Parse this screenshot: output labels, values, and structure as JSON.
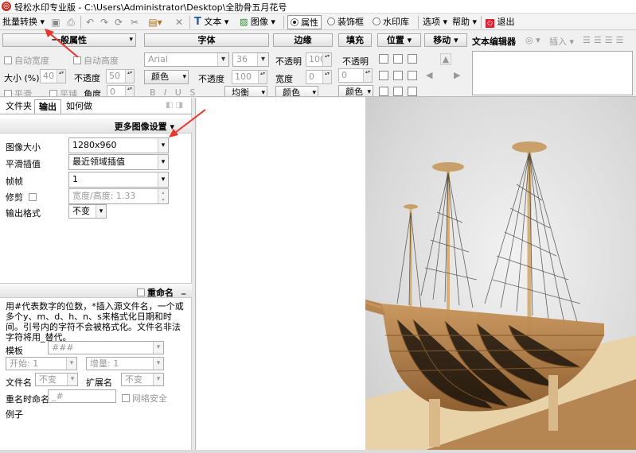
{
  "title": "轻松水印专业版 - C:\\Users\\Administrator\\Desktop\\全肋骨五月花号",
  "menu": {
    "batch": "批量转换",
    "text": "文本",
    "image": "图像",
    "props": "属性",
    "deco": "装饰框",
    "wmlib": "水印库",
    "options": "选项",
    "help": "帮助",
    "exit": "退出"
  },
  "ribbon": {
    "general": "一般属性",
    "font": "字体",
    "border": "边缘",
    "fill": "填充",
    "position": "位置",
    "move": "移动",
    "text_editor": "文本编辑器",
    "insert": "插入",
    "auto_width": "自动宽度",
    "auto_height": "自动高度",
    "font_name": "Arial",
    "font_size": "36",
    "opacity": "不透明",
    "opacity_val": "100",
    "size_pct": "大小 (%)",
    "size_val": "40",
    "opacity2": "不透度",
    "opacity2_val": "50",
    "color": "颜色",
    "opacity3": "不透度",
    "opacity3_val": "100",
    "width": "宽度",
    "width_val": "0",
    "fill_val": "0",
    "smooth": "平滑",
    "tile": "平铺",
    "angle": "角度",
    "angle_val": "0",
    "align": "均衡",
    "color2": "颜色",
    "color3": "颜色"
  },
  "left": {
    "tabs": [
      "文件夹",
      "输出",
      "如何做"
    ],
    "more_settings": "更多图像设置",
    "image_size_label": "图像大小",
    "image_size": "1280x960",
    "smooth_label": "平滑插值",
    "smooth_val": "最近领域插值",
    "frame_label": "帧帧",
    "frame_val": "1",
    "crop_label": "修剪",
    "crop_val": "宽度/高度: 1.33",
    "format_label": "输出格式",
    "format_val": "不变",
    "rename": "重命名",
    "rename_help": "用#代表数字的位数，*插入源文件名，一个或多个y、m、d、h、n、s来格式化日期和时间。引号内的字符不会被格式化。文件名非法字符将用_替代。",
    "template_label": "模板",
    "template_val": "###",
    "start_label": "开始: 1",
    "inc_label": "增量: 1",
    "filename_label": "文件名",
    "filename_val": "不变",
    "ext_label": "扩展名",
    "ext_val": "不变",
    "rename_when": "重名时命名",
    "rename_when_val": "_#",
    "net_safe": "网络安全",
    "example": "例子"
  },
  "colors": {
    "arrow": "#e8352a",
    "accent": "#2a5db0"
  }
}
